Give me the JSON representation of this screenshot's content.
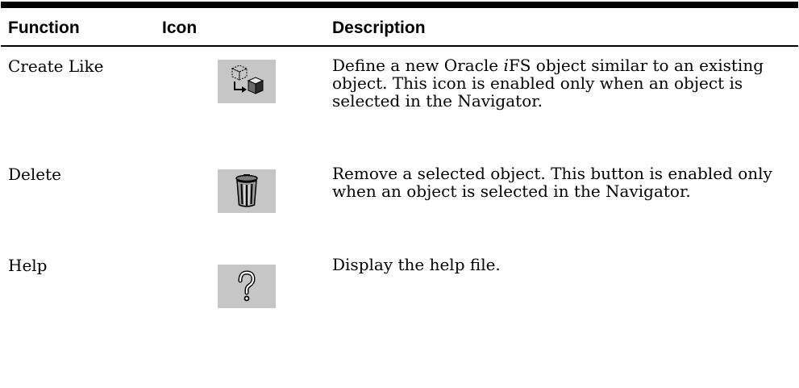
{
  "table": {
    "headers": {
      "function": "Function",
      "icon": "Icon",
      "description": "Description"
    },
    "rows": [
      {
        "function": "Create Like",
        "icon": "create-like-icon",
        "description_parts": [
          "Define a new Oracle ",
          "i",
          "FS object similar to an existing object. This icon is enabled only when an object is selected in the Navigator."
        ]
      },
      {
        "function": "Delete",
        "icon": "trash-can-icon",
        "description": "Remove a selected object. This button is enabled only when an object is selected in the Navigator."
      },
      {
        "function": "Help",
        "icon": "question-mark-icon",
        "description": "Display the help file."
      }
    ]
  },
  "colors": {
    "icon_background": "#c6c6c6",
    "rules": "#000000"
  }
}
